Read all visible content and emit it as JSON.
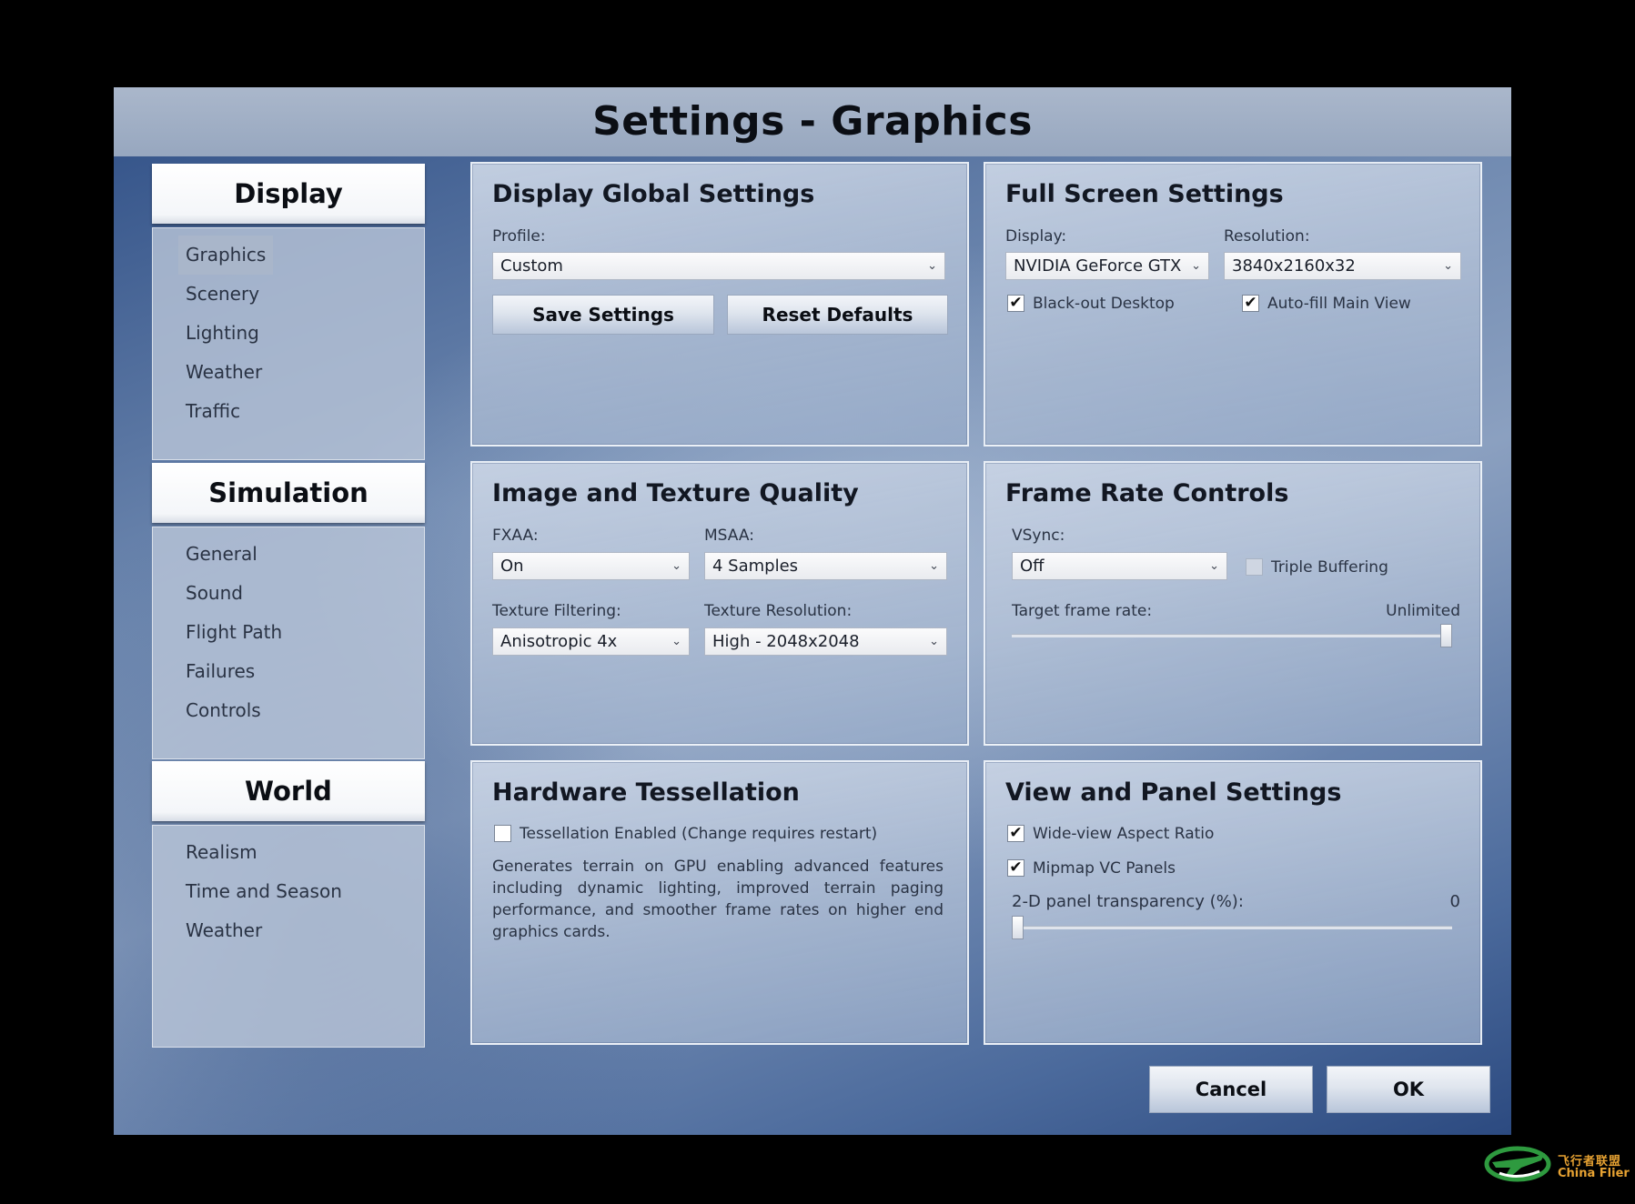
{
  "window": {
    "title": "Settings - Graphics"
  },
  "sidebar": {
    "groups": [
      {
        "header": "Display",
        "items": [
          "Graphics",
          "Scenery",
          "Lighting",
          "Weather",
          "Traffic"
        ],
        "active": "Graphics"
      },
      {
        "header": "Simulation",
        "items": [
          "General",
          "Sound",
          "Flight Path",
          "Failures",
          "Controls"
        ]
      },
      {
        "header": "World",
        "items": [
          "Realism",
          "Time and Season",
          "Weather"
        ]
      }
    ]
  },
  "display_global": {
    "title": "Display Global Settings",
    "profile_label": "Profile:",
    "profile_value": "Custom",
    "save_label": "Save Settings",
    "reset_label": "Reset Defaults"
  },
  "full_screen": {
    "title": "Full Screen Settings",
    "display_label": "Display:",
    "display_value": "NVIDIA GeForce GTX",
    "resolution_label": "Resolution:",
    "resolution_value": "3840x2160x32",
    "blackout_label": "Black-out Desktop",
    "blackout_checked": true,
    "autofill_label": "Auto-fill Main View",
    "autofill_checked": true
  },
  "image_quality": {
    "title": "Image and Texture Quality",
    "fxaa_label": "FXAA:",
    "fxaa_value": "On",
    "msaa_label": "MSAA:",
    "msaa_value": "4 Samples",
    "filtering_label": "Texture Filtering:",
    "filtering_value": "Anisotropic 4x",
    "resolution_label": "Texture Resolution:",
    "resolution_value": "High - 2048x2048"
  },
  "frame_rate": {
    "title": "Frame Rate Controls",
    "vsync_label": "VSync:",
    "vsync_value": "Off",
    "triple_label": "Triple Buffering",
    "triple_checked": false,
    "target_label": "Target frame rate:",
    "target_value": "Unlimited",
    "target_fraction": 1.0
  },
  "tessellation": {
    "title": "Hardware Tessellation",
    "enabled_label": "Tessellation Enabled (Change requires restart)",
    "enabled_checked": false,
    "description": "Generates terrain on GPU enabling advanced features including dynamic lighting, improved terrain paging performance, and smoother frame rates on higher end graphics cards."
  },
  "view_panel": {
    "title": "View and Panel Settings",
    "wideview_label": "Wide-view Aspect Ratio",
    "wideview_checked": true,
    "mipmap_label": "Mipmap VC Panels",
    "mipmap_checked": true,
    "transparency_label": "2-D panel transparency (%):",
    "transparency_value": "0",
    "transparency_fraction": 0.0
  },
  "footer": {
    "cancel_label": "Cancel",
    "ok_label": "OK"
  },
  "watermark": {
    "cn_text": "飞行者联盟",
    "en_text": "China Flier"
  },
  "icons": {
    "check": "check-icon",
    "dropdown": "chevron-down-icon",
    "logo": "airplane-logo-icon"
  },
  "colors": {
    "accent": "#2f4f86",
    "titlebar": "#9fadc4",
    "watermark_green": "#2e9a3f",
    "watermark_orange": "#e7a232"
  }
}
